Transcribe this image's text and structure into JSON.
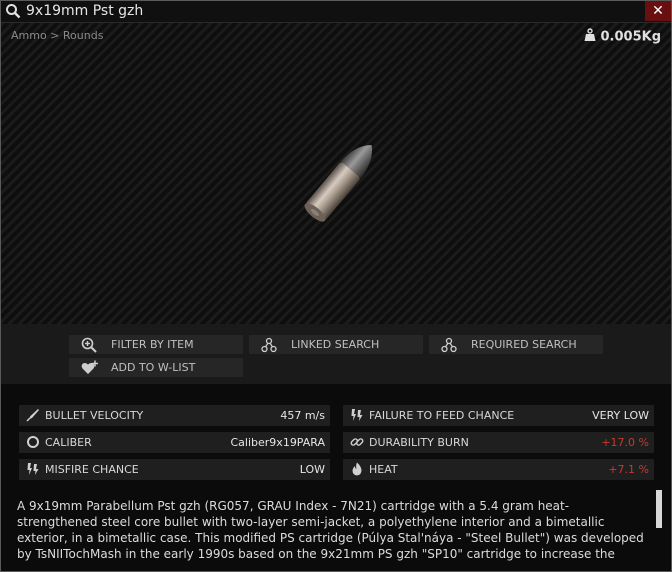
{
  "window": {
    "title": "9x19mm Pst gzh",
    "close_label": "✕"
  },
  "preview": {
    "breadcrumb": "Ammo > Rounds",
    "weight": "0.005Kg"
  },
  "actions": {
    "filter_by_item": "FILTER BY ITEM",
    "linked_search": "LINKED SEARCH",
    "required_search": "REQUIRED SEARCH",
    "add_to_wishlist": "ADD TO W-LIST"
  },
  "stats": {
    "bullet_velocity": {
      "label": "BULLET VELOCITY",
      "value": "457 m/s"
    },
    "caliber": {
      "label": "CALIBER",
      "value": "Caliber9x19PARA"
    },
    "misfire_chance": {
      "label": "MISFIRE CHANCE",
      "value": "LOW"
    },
    "failure_to_feed": {
      "label": "FAILURE TO FEED CHANCE",
      "value": "VERY LOW"
    },
    "durability_burn": {
      "label": "DURABILITY BURN",
      "value": "+17.0 %"
    },
    "heat": {
      "label": "HEAT",
      "value": "+7.1 %"
    }
  },
  "description": {
    "text": "A 9x19mm Parabellum Pst gzh (RG057, GRAU Index - 7N21) cartridge with a 5.4 gram heat-strengthened steel core bullet with two-layer semi-jacket, a polyethylene interior and a bimetallic exterior, in a bimetallic case. This modified PS cartridge (Púlya Stal'náya - \"Steel Bullet\") was developed by TsNIITochMash in the early 1990s based on the 9x21mm PS gzh \"SP10\" cartridge to increase the"
  },
  "colors": {
    "accent_red": "#c8392e",
    "close_red": "#6a0f0f",
    "panel_bg": "#1f1f1f"
  },
  "icons": {
    "title": "search-icon",
    "weight": "weight-icon",
    "filter": "magnifier-plus-icon",
    "linked": "network-icon",
    "required": "network-icon",
    "wishlist": "heart-plus-icon"
  }
}
